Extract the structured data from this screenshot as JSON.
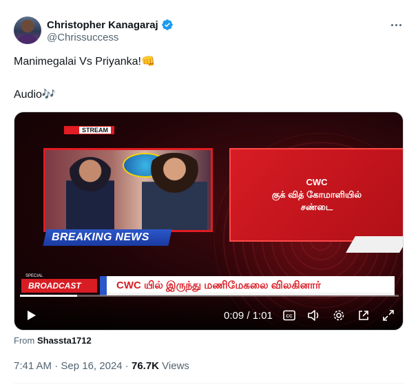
{
  "author": {
    "display_name": "Christopher Kanagaraj",
    "handle": "@Chrissuccess",
    "verified": true,
    "verified_color": "#1d9bf0"
  },
  "tweet": {
    "line1": "Manimegalai Vs Priyanka!",
    "line1_emoji": "👊",
    "line2": "Audio",
    "line2_emoji": "🎶"
  },
  "video": {
    "stream_label": "STREAM",
    "breaking_news": "BREAKING NEWS",
    "panel_line1": "CWC",
    "panel_line2": "குக் வித் கோமாளியில்",
    "panel_line3": "சண்டை",
    "special_label": "SPECIAL",
    "broadcast_label": "BROADCAST",
    "ticker_text": "CWC யில் இருந்து மணிமேகலை விலகினார்",
    "current_time": "0:09",
    "duration": "1:01",
    "time_display": "0:09 / 1:01",
    "progress_fraction": 0.15,
    "controls": [
      "play-icon",
      "captions-icon",
      "volume-icon",
      "settings-icon",
      "pop-out-icon",
      "fullscreen-icon"
    ]
  },
  "source": {
    "prefix": "From",
    "name": "Shassta1712"
  },
  "meta": {
    "time": "7:41 AM",
    "date": "Sep 16, 2024",
    "separator": " · ",
    "views_count": "76.7K",
    "views_label": " Views"
  }
}
